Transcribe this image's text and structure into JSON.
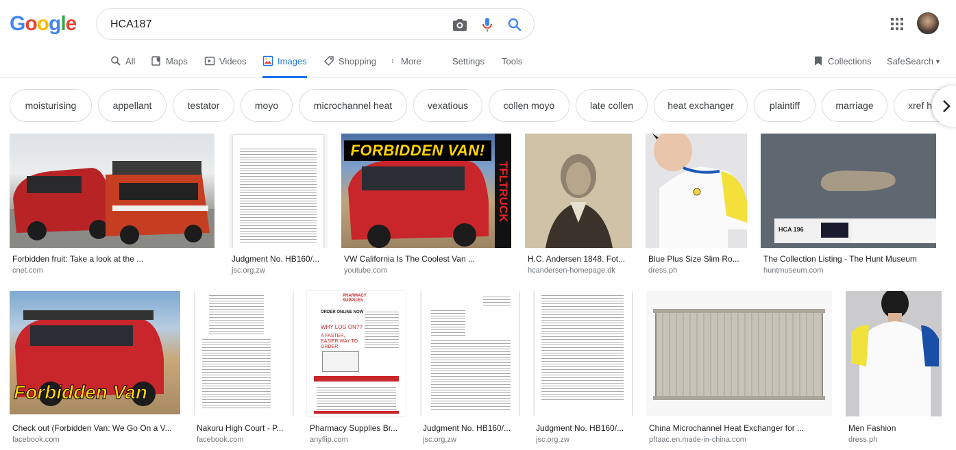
{
  "logo": {
    "letters": [
      "G",
      "o",
      "o",
      "g",
      "l",
      "e"
    ],
    "colors": [
      "#4285f4",
      "#ea4335",
      "#fbbc05",
      "#4285f4",
      "#34a853",
      "#ea4335"
    ]
  },
  "search": {
    "query": "HCA187"
  },
  "tabs": {
    "all": "All",
    "maps": "Maps",
    "videos": "Videos",
    "images": "Images",
    "shopping": "Shopping",
    "more": "More",
    "settings": "Settings",
    "tools": "Tools",
    "collections": "Collections",
    "safesearch": "SafeSearch"
  },
  "chips": [
    "moisturising",
    "appellant",
    "testator",
    "moyo",
    "microchannel heat",
    "vexatious",
    "collen moyo",
    "late collen",
    "heat exchanger",
    "plaintiff",
    "marriage",
    "xref hc"
  ],
  "results": [
    {
      "title": "Forbidden fruit: Take a look at the ...",
      "site": "cnet.com"
    },
    {
      "title": "Judgment No. HB160/...",
      "site": "jsc.org.zw"
    },
    {
      "title": "VW California Is The Coolest Van ...",
      "site": "youtube.com",
      "overlay": "FORBIDDEN VAN!",
      "side": "TFLTRUCK"
    },
    {
      "title": "H.C. Andersen 1848. Fot...",
      "site": "hcandersen-homepage.dk"
    },
    {
      "title": "Blue Plus Size Slim Ro...",
      "site": "dress.ph"
    },
    {
      "title": "The Collection Listing - The Hunt Museum",
      "site": "huntmuseum.com",
      "label": "HCA 196"
    },
    {
      "title": "Check out (Forbidden Van: We Go On a V...",
      "site": "facebook.com",
      "overlay": "Forbidden Van"
    },
    {
      "title": "Nakuru High Court - P...",
      "site": "facebook.com"
    },
    {
      "title": "Pharmacy Supplies Br...",
      "site": "anyflip.com",
      "brand": "PHARMACY SUPPLIES",
      "order": "ORDER ONLINE NOW",
      "why": "WHY LOG ON??",
      "faster": "A FASTER, EASIER WAY TO ORDER"
    },
    {
      "title": "Judgment No. HB160/...",
      "site": "jsc.org.zw"
    },
    {
      "title": "Judgment No. HB160/...",
      "site": "jsc.org.zw"
    },
    {
      "title": "China Microchannel Heat Exchanger for ...",
      "site": "pftaac.en.made-in-china.com"
    },
    {
      "title": "Men Fashion",
      "site": "dress.ph"
    }
  ],
  "colors": {
    "accent": "#1a73e8",
    "van_red": "#c8262a"
  }
}
